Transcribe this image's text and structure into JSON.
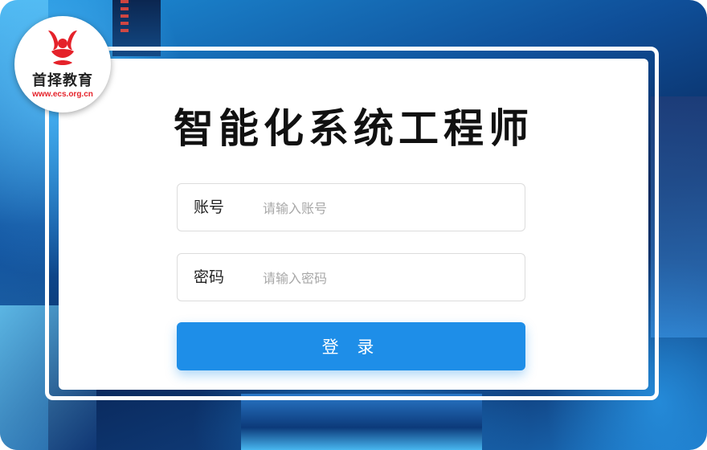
{
  "logo": {
    "name_cn": "首择教育",
    "url": "www.ecs.org.cn",
    "icon": "ecs-logo-icon",
    "brand_color": "#e5222a"
  },
  "title": "智能化系统工程师",
  "form": {
    "username": {
      "label": "账号",
      "placeholder": "请输入账号",
      "value": ""
    },
    "password": {
      "label": "密码",
      "placeholder": "请输入密码",
      "value": ""
    },
    "submit_label": "登 录"
  },
  "colors": {
    "accent": "#1e8ee8",
    "background_dark": "#0a2a5e",
    "background_light": "#1d8fd8"
  }
}
